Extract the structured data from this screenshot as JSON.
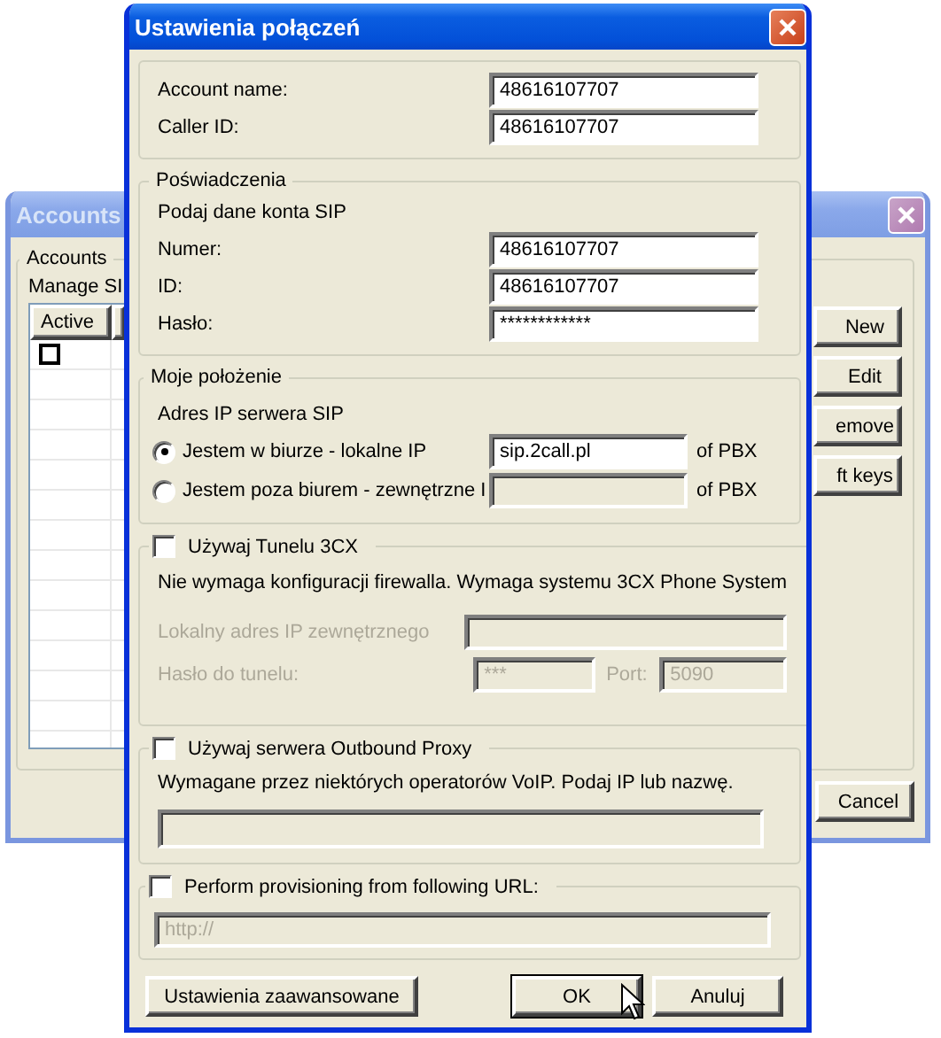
{
  "accounts_window": {
    "title": "Accounts",
    "group_label": "Accounts",
    "description": "Manage SI",
    "columns": [
      "Active"
    ],
    "rows": [
      {
        "active": false
      }
    ],
    "buttons": [
      "New",
      "Edit",
      "emove",
      "ft keys"
    ],
    "cancel_button": "Cancel"
  },
  "dialog": {
    "title": "Ustawienia połączeń",
    "account": {
      "fields": [
        {
          "label": "Account name:",
          "value": "48616107707"
        },
        {
          "label": "Caller ID:",
          "value": "48616107707"
        }
      ]
    },
    "credentials": {
      "title": "Poświadczenia",
      "subtitle": "Podaj dane konta SIP",
      "fields": [
        {
          "label": "Numer:",
          "value": "48616107707"
        },
        {
          "label": "ID:",
          "value": "48616107707"
        },
        {
          "label": "Hasło:",
          "value": "************"
        }
      ]
    },
    "location": {
      "title": "Moje położenie",
      "subtitle": "Adres IP serwera SIP",
      "options": [
        {
          "label": "Jestem w biurze - lokalne IP",
          "selected": true,
          "value": "sip.2call.pl",
          "suffix": "of PBX"
        },
        {
          "label": "Jestem poza biurem - zewnętrzne I",
          "selected": false,
          "suffix": "of PBX"
        }
      ]
    },
    "tunnel": {
      "label": "Używaj Tunelu 3CX",
      "checked": false,
      "note": "Nie wymaga konfiguracji firewalla. Wymaga systemu 3CX Phone System",
      "local_ip_label": "Lokalny adres IP zewnętrznego",
      "password_label": "Hasło do tunelu:",
      "password_value": "***",
      "port_label": "Port:",
      "port_value": "5090"
    },
    "proxy": {
      "label": "Używaj serwera Outbound Proxy",
      "checked": false,
      "note": "Wymagane przez niektórych operatorów VoIP. Podaj IP lub nazwę."
    },
    "provisioning": {
      "label": "Perform provisioning from following URL:",
      "checked": false,
      "url": "http://"
    },
    "buttons": {
      "advanced": "Ustawienia zaawansowane",
      "ok": "OK",
      "cancel": "Anuluj"
    }
  }
}
